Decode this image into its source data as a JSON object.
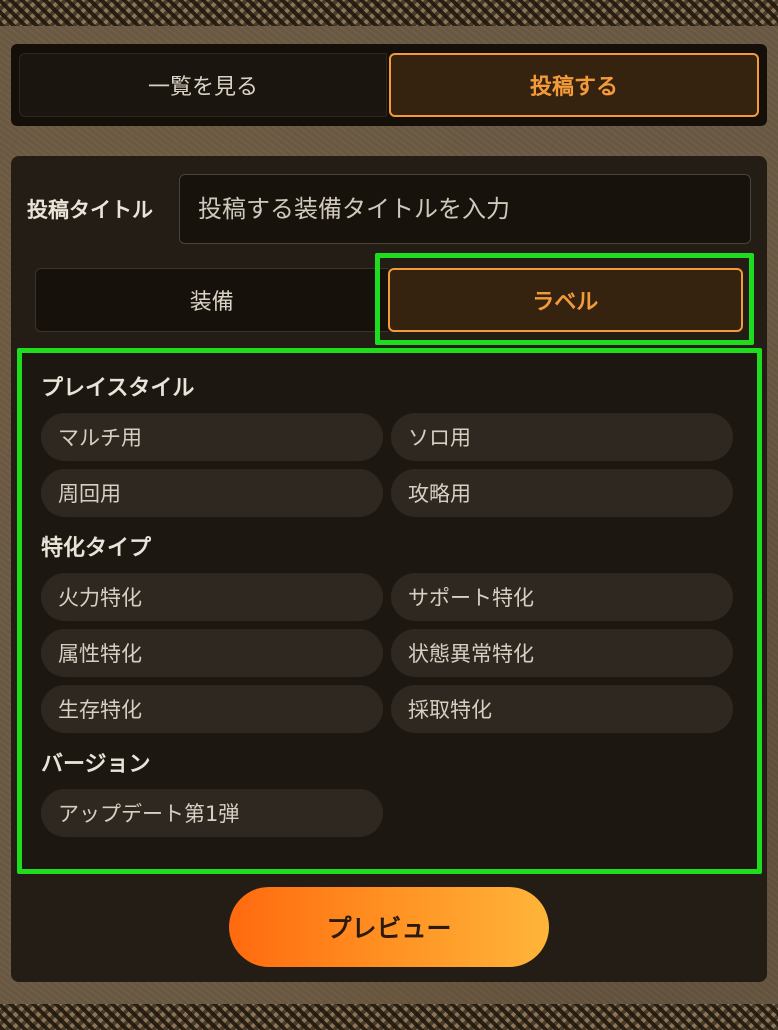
{
  "top_tabs": {
    "list_label": "一覧を見る",
    "post_label": "投稿する",
    "active": "post"
  },
  "form": {
    "title_label": "投稿タイトル",
    "title_placeholder": "投稿する装備タイトルを入力",
    "title_value": ""
  },
  "sub_tabs": {
    "equipment_label": "装備",
    "label_label": "ラベル",
    "active": "label"
  },
  "label_groups": [
    {
      "title": "プレイスタイル",
      "options": [
        "マルチ用",
        "ソロ用",
        "周回用",
        "攻略用"
      ]
    },
    {
      "title": "特化タイプ",
      "options": [
        "火力特化",
        "サポート特化",
        "属性特化",
        "状態異常特化",
        "生存特化",
        "採取特化"
      ]
    },
    {
      "title": "バージョン",
      "options": [
        "アップデート第1弾"
      ]
    }
  ],
  "preview_button": {
    "label": "プレビュー"
  },
  "colors": {
    "accent": "#f39a3b",
    "highlight": "#1fdc1f",
    "panel": "#231d16",
    "chip": "#2f2820"
  }
}
